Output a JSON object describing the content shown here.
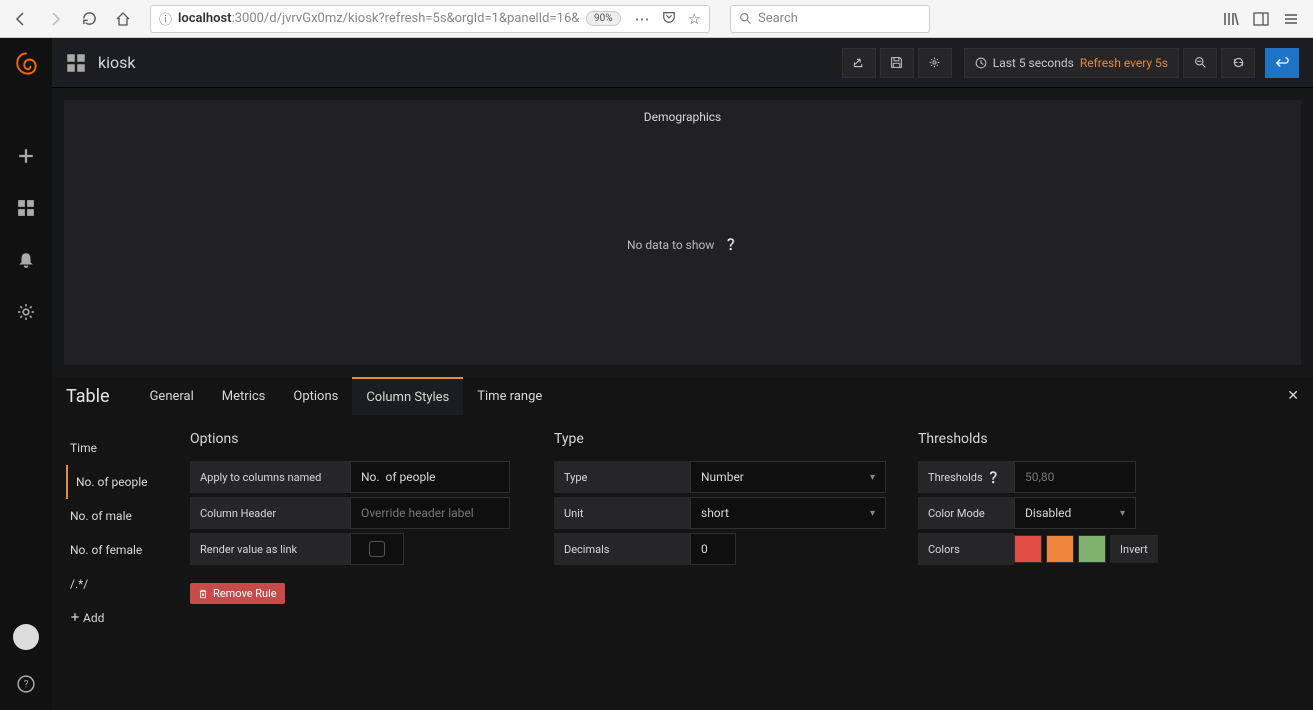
{
  "browser": {
    "url_host": "localhost",
    "url_rest": ":3000/d/jvrvGx0mz/kiosk?refresh=5s&orgId=1&panelId=16&",
    "zoom": "90%",
    "search_placeholder": "Search"
  },
  "topbar": {
    "title": "kiosk",
    "time_label": "Last 5 seconds",
    "refresh_label": "Refresh every 5s"
  },
  "panel": {
    "title": "Demographics",
    "empty_text": "No data to show"
  },
  "editor": {
    "label": "Table",
    "tabs": [
      "General",
      "Metrics",
      "Options",
      "Column Styles",
      "Time range"
    ],
    "active_tab": "Column Styles",
    "rules": [
      "Time",
      "No. of people",
      "No. of male",
      "No. of female",
      "/.*/"
    ],
    "active_rule": "No. of people",
    "add_label": "Add",
    "options": {
      "heading": "Options",
      "apply_label": "Apply to columns named",
      "apply_value": "No.  of people",
      "header_label": "Column Header",
      "header_placeholder": "Override header label",
      "link_label": "Render value as link",
      "remove_label": "Remove Rule"
    },
    "type": {
      "heading": "Type",
      "type_label": "Type",
      "type_value": "Number",
      "unit_label": "Unit",
      "unit_value": "short",
      "decimals_label": "Decimals",
      "decimals_value": "0"
    },
    "thresholds": {
      "heading": "Thresholds",
      "th_label": "Thresholds",
      "th_placeholder": "50,80",
      "mode_label": "Color Mode",
      "mode_value": "Disabled",
      "colors_label": "Colors",
      "invert_label": "Invert",
      "swatches": [
        "#e24d42",
        "#ef843c",
        "#7eb26d"
      ]
    }
  }
}
